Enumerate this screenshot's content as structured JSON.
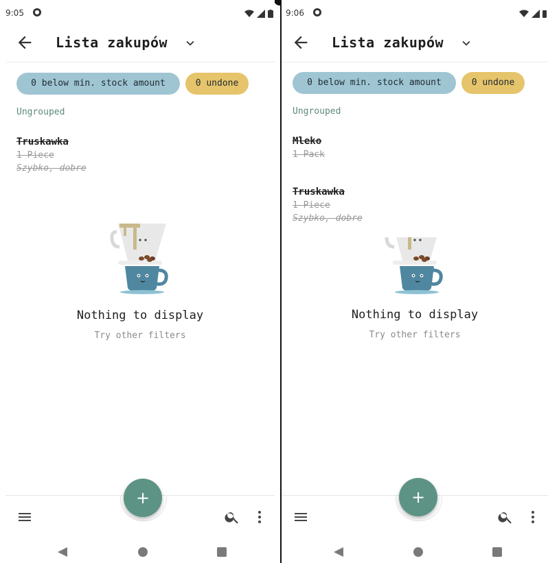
{
  "screens": [
    {
      "status": {
        "time": "9:05"
      },
      "appbar": {
        "title": "Lista zakupów"
      },
      "chips": {
        "below_min": "0 below min. stock amount",
        "undone": "0 undone"
      },
      "group_label": "Ungrouped",
      "items": [
        {
          "name": "Truskawka",
          "amount": "1 Piece",
          "note": "Szybko, dobre"
        }
      ],
      "empty_state": {
        "title": "Nothing to display",
        "subtitle": "Try other filters"
      },
      "fab": {
        "label": "+"
      }
    },
    {
      "status": {
        "time": "9:06"
      },
      "appbar": {
        "title": "Lista zakupów"
      },
      "chips": {
        "below_min": "0 below min. stock amount",
        "undone": "0 undone"
      },
      "group_label": "Ungrouped",
      "items": [
        {
          "name": "Mleko",
          "amount": "1 Pack"
        },
        {
          "name": "Truskawka",
          "amount": "1 Piece",
          "note": "Szybko, dobre"
        }
      ],
      "empty_state": {
        "title": "Nothing to display",
        "subtitle": "Try other filters"
      },
      "fab": {
        "label": "+"
      }
    }
  ],
  "colors": {
    "chip_blue": "#9fc5d3",
    "chip_yellow": "#e6c46b",
    "accent_green": "#5d9384",
    "group_label": "#5d8a76"
  },
  "icons": {
    "back": "arrow-left-icon",
    "dropdown": "chevron-down-icon",
    "menu": "hamburger-menu-icon",
    "search": "search-icon",
    "more": "more-vertical-icon",
    "fab": "plus-icon"
  }
}
